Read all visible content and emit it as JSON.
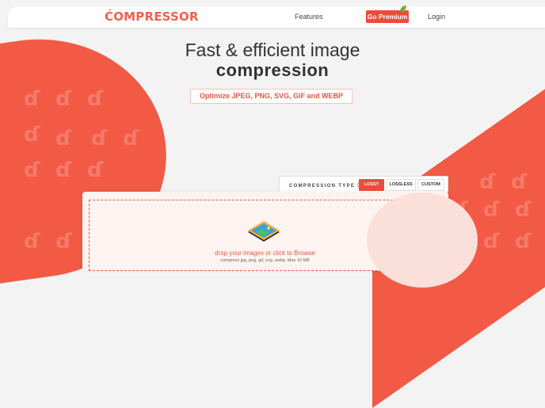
{
  "brand": {
    "logo": "ĆOMPRESSOR"
  },
  "nav": {
    "features": "Features",
    "premium": "Go Premium",
    "login": "Login"
  },
  "hero": {
    "line1": "Fast & efficient image",
    "line2": "compression",
    "formats": "Optimize JPEG, PNG, SVG, GIF and WEBP"
  },
  "compression": {
    "label": "COMPRESSION TYPE ⓘ :",
    "options": [
      "LOSSY",
      "LOSSLESS",
      "CUSTOM"
    ],
    "selected": "LOSSY"
  },
  "dropzone": {
    "main": "drop your images or click to Browse",
    "sub": "compress jpg, png, gif, svg, webp. Max 10 MB"
  },
  "colors": {
    "accent": "#f04a3a",
    "background_shape": "#f25a45",
    "page_background": "#f3f3f3"
  },
  "icons": {
    "drop_zone": "image-stack-icon",
    "premium": "leaf-icon"
  }
}
